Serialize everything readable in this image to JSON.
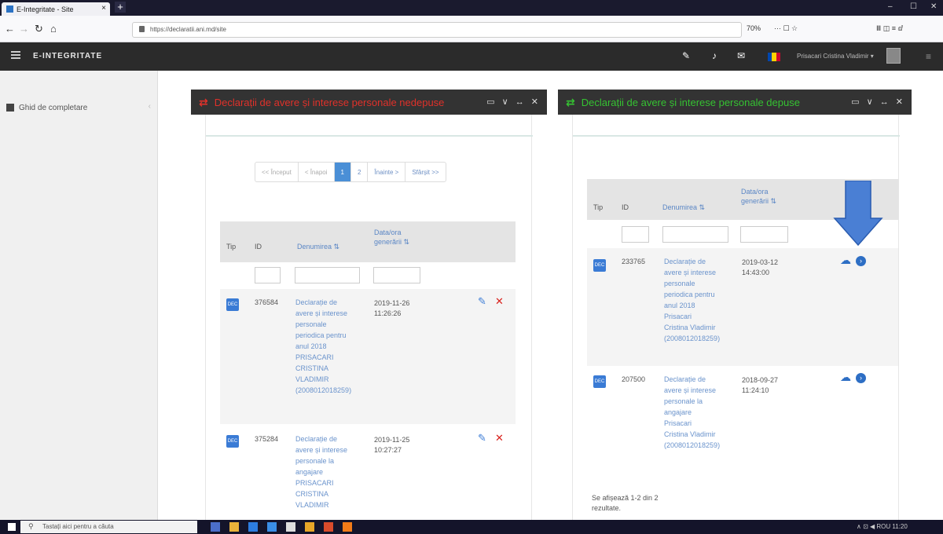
{
  "browser": {
    "tab_title": "E-Integritate - Site",
    "tab_close": "×",
    "new_tab": "+",
    "url": "https://declaratii.ani.md/site",
    "zoom": "70%",
    "toolbar_right": "··· ☐ ☆",
    "ext_icons": "Ⅲ ◫ ≡ ⅆ",
    "win_min": "–",
    "win_max": "☐",
    "win_close": "✕",
    "back": "←",
    "forward": "→",
    "reload": "↻",
    "home": "⌂"
  },
  "header": {
    "brand": "E-INTEGRITATE",
    "user": "Prisacari Cristina Vladimir ▾",
    "flag_colors": [
      "#0046ae",
      "#ffd200",
      "#cc092f"
    ],
    "icons": [
      "wrench-icon",
      "bell-icon",
      "envelope-icon",
      "flag-icon"
    ]
  },
  "sidebar": {
    "items": [
      {
        "label": "Ghid de completare",
        "icon": "book-icon"
      }
    ]
  },
  "left_panel": {
    "title": "Declarații de avere și interese personale nedepuse",
    "title_color": "#e0312a",
    "tools": "▭ ∨ ↔ ✕",
    "pager": [
      {
        "label": "<< Început",
        "state": "disabled"
      },
      {
        "label": "< Înapoi",
        "state": "disabled"
      },
      {
        "label": "1",
        "state": "active"
      },
      {
        "label": "2",
        "state": "normal"
      },
      {
        "label": "Înainte >",
        "state": "normal"
      },
      {
        "label": "Sfârșit >>",
        "state": "normal"
      }
    ],
    "columns": {
      "tip": "Tip",
      "id": "ID",
      "name": "Denumirea ⇅",
      "date": "Data/ora generării ⇅"
    },
    "rows": [
      {
        "type": "DEC",
        "id": "376584",
        "name_lines": [
          "Declarație de",
          "avere și interese",
          "personale",
          "periodica pentru",
          "anul 2018",
          "PRISACARI",
          "CRISTINA",
          "VLADIMIR",
          "(2008012018259)"
        ],
        "date_lines": [
          "2019-11-26",
          "11:26:26"
        ]
      },
      {
        "type": "DEC",
        "id": "375284",
        "name_lines": [
          "Declarație de",
          "avere și interese",
          "personale la",
          "angajare",
          "PRISACARI",
          "CRISTINA",
          "VLADIMIR"
        ],
        "date_lines": [
          "2019-11-25",
          "10:27:27"
        ]
      }
    ]
  },
  "right_panel": {
    "title": "Declarații de avere și interese personale depuse",
    "title_color": "#35c232",
    "tools": "▭ ∨ ↔ ✕",
    "columns": {
      "tip": "Tip",
      "id": "ID",
      "name": "Denumirea ⇅",
      "date": "Data/ora generării ⇅"
    },
    "rows": [
      {
        "type": "DEC",
        "id": "233765",
        "name_lines": [
          "Declarație de",
          "avere și interese",
          "personale",
          "periodica pentru",
          "anul 2018",
          "Prisacari",
          "Cristina Vladimir",
          "(2008012018259)"
        ],
        "date_lines": [
          "2019-03-12",
          "14:43:00"
        ]
      },
      {
        "type": "DEC",
        "id": "207500",
        "name_lines": [
          "Declarație de",
          "avere și interese",
          "personale la",
          "angajare",
          "Prisacari",
          "Cristina Vladimir",
          "(2008012018259)"
        ],
        "date_lines": [
          "2018-09-27",
          "11:24:10"
        ]
      }
    ],
    "summary_lines": [
      "Se afișează 1-2 din 2",
      "rezultate."
    ]
  },
  "taskbar": {
    "search_placeholder": "Tastați aici pentru a căuta",
    "tray_text": "∧ ⊡ ◀ ROU 11:20"
  },
  "annotation": {
    "arrow_color": "#4a7fd4"
  }
}
